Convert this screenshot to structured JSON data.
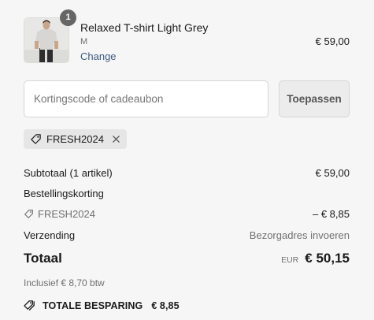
{
  "product": {
    "quantity": "1",
    "name": "Relaxed T-shirt Light Grey",
    "variant": "M",
    "change_label": "Change",
    "price": "€ 59,00",
    "image_icon": "person-wearing-tshirt-photo"
  },
  "discount": {
    "placeholder": "Kortingscode of cadeaubon",
    "value": "",
    "apply_label": "Toepassen",
    "applied_code": "FRESH2024"
  },
  "summary": {
    "subtotal_label": "Subtotaal (1 artikel)",
    "subtotal_value": "€ 59,00",
    "order_discount_label": "Bestellingskorting",
    "discount_code": "FRESH2024",
    "discount_value": "– € 8,85",
    "shipping_label": "Verzending",
    "shipping_value": "Bezorgadres invoeren",
    "total_label": "Totaal",
    "currency": "EUR",
    "total_value": "€ 50,15",
    "tax_note": "Inclusief € 8,70 btw",
    "savings_label": "TOTALE BESPARING",
    "savings_value": "€ 8,85"
  },
  "colors": {
    "background": "#f6f6f6",
    "link": "#3d5a80",
    "badge": "#666666",
    "muted_text": "#707070"
  }
}
